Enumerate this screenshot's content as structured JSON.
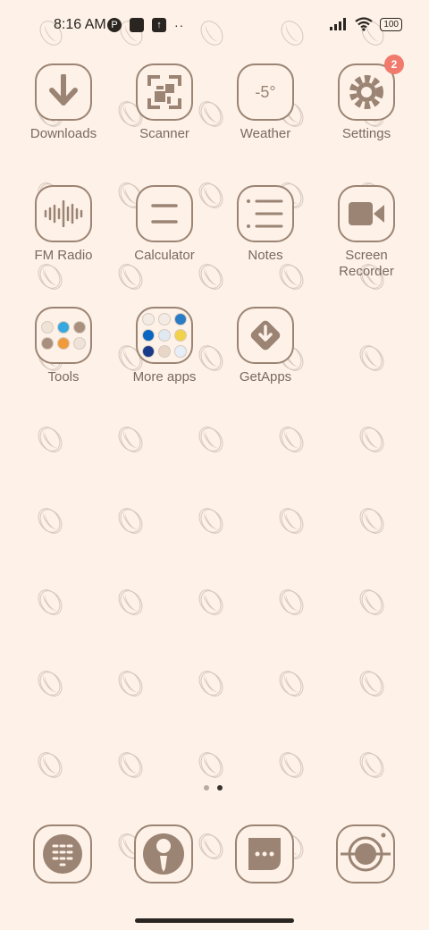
{
  "status_bar": {
    "time": "8:16 AM",
    "dots": "··",
    "battery": "100"
  },
  "apps": [
    {
      "label": "Downloads",
      "icon": "download-icon"
    },
    {
      "label": "Scanner",
      "icon": "scanner-icon"
    },
    {
      "label": "Weather",
      "icon": "weather-icon",
      "icon_text": "-5°"
    },
    {
      "label": "Settings",
      "icon": "gear-icon",
      "badge": "2"
    },
    {
      "label": "FM Radio",
      "icon": "radio-wave-icon"
    },
    {
      "label": "Calculator",
      "icon": "calculator-icon"
    },
    {
      "label": "Notes",
      "icon": "notes-icon"
    },
    {
      "label": "Screen Recorder",
      "icon": "video-camera-icon"
    },
    {
      "label": "Tools",
      "icon": "folder-icon"
    },
    {
      "label": "More apps",
      "icon": "folder-icon"
    },
    {
      "label": "GetApps",
      "icon": "getapps-icon"
    }
  ],
  "dock": [
    {
      "icon": "phone-dialpad-icon"
    },
    {
      "icon": "contacts-icon"
    },
    {
      "icon": "messages-icon"
    },
    {
      "icon": "camera-icon"
    }
  ],
  "pager": {
    "pages": 2,
    "current": 2
  },
  "colors": {
    "background": "#fdf1e8",
    "icon_brown": "#9b8473",
    "badge": "#f07a6c"
  }
}
